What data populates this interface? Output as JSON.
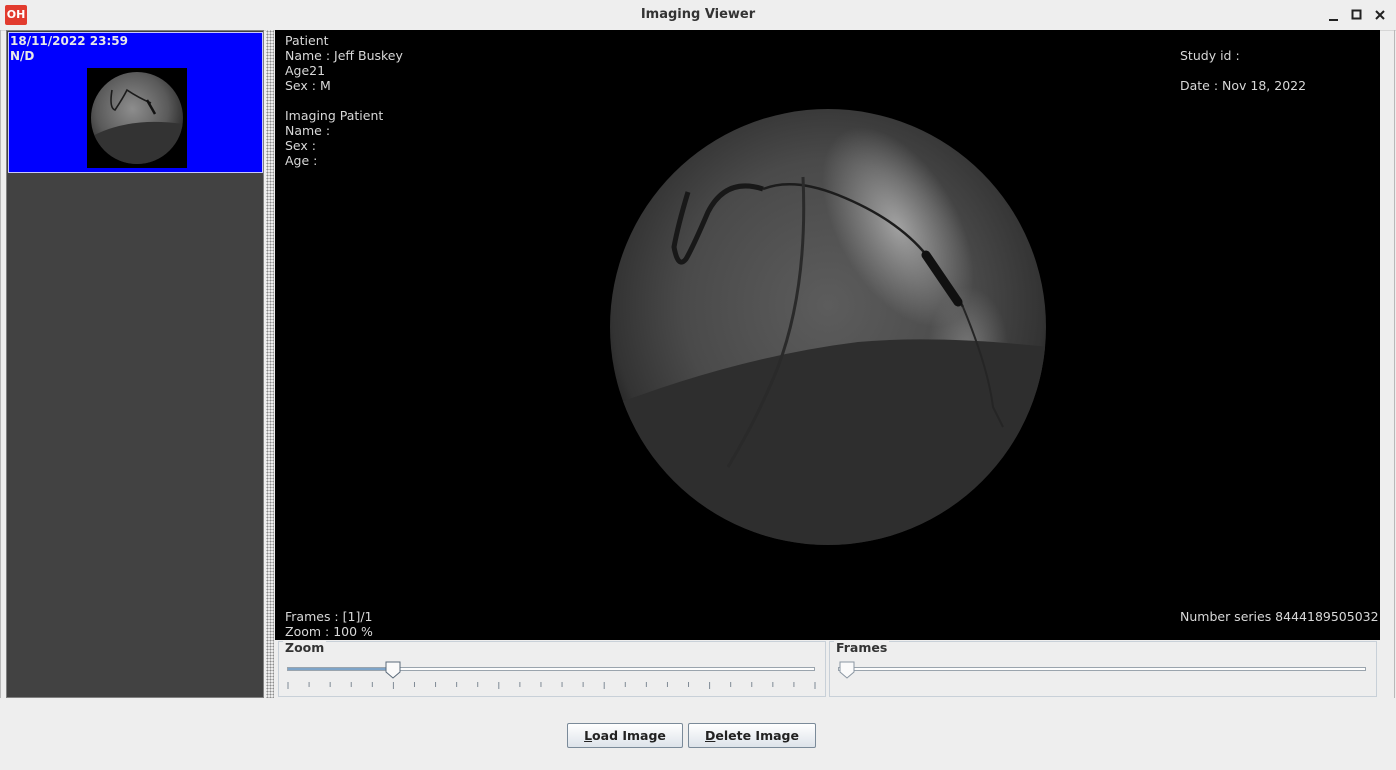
{
  "window": {
    "title": "Imaging Viewer",
    "app_icon_text": "OH",
    "controls": [
      "minimize-icon",
      "maximize-icon",
      "close-icon"
    ]
  },
  "sidebar": {
    "items": [
      {
        "date": "18/11/2022 23:59",
        "label": "N/D",
        "selected": true
      }
    ],
    "selected_color": "#0000ff"
  },
  "viewer": {
    "patient": {
      "header": "Patient",
      "name": "Name : Jeff Buskey",
      "age": "Age21",
      "sex": "Sex : M"
    },
    "imaging_patient": {
      "header": "Imaging Patient",
      "name": "Name :",
      "sex": "Sex :",
      "age": "Age :"
    },
    "study_id": "Study id :",
    "date": "Date : Nov 18, 2022",
    "frames": "Frames : [1]/1",
    "zoom": "Zoom : 100 %",
    "number_series": "Number series 8444189505032"
  },
  "sliders": {
    "zoom": {
      "label": "Zoom",
      "value": 0.2
    },
    "frames": {
      "label": "Frames",
      "value": 0
    }
  },
  "buttons": {
    "load": {
      "mnemonic": "L",
      "rest": "oad Image"
    },
    "delete": {
      "mnemonic": "D",
      "rest": "elete Image"
    }
  }
}
